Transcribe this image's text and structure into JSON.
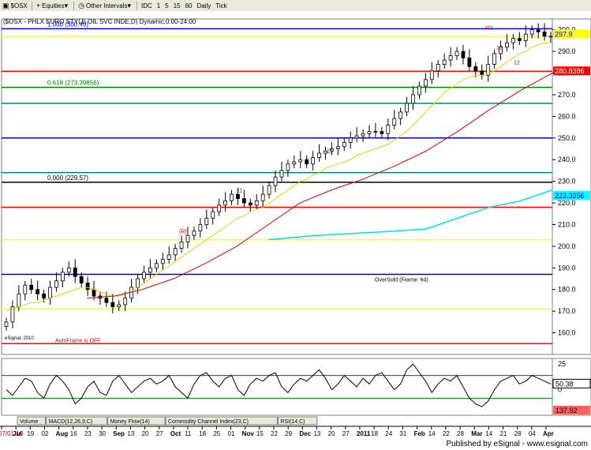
{
  "toolbar": {
    "symbol": "$OSX",
    "category": "Equities",
    "intervals_menu": "Other Intervals",
    "buttons": [
      "IDC",
      "1",
      "5",
      "15",
      "60",
      "Daily",
      "Tick"
    ]
  },
  "chart_data": [
    {
      "type": "candlestick",
      "title": "($OSX - PHLX EURO STYLE OIL SVC INDE,D) Dynamic,0:00-24:00",
      "ylim": [
        150,
        305
      ],
      "y_ticks": [
        160,
        170,
        180,
        190,
        200,
        210,
        220,
        230,
        240,
        250,
        260,
        270,
        280,
        290,
        300
      ],
      "x_ticks": [
        "07/01/10",
        "Jul",
        "19",
        "02",
        "Aug",
        "16",
        "23",
        "30",
        "Sep",
        "13",
        "20",
        "27",
        "Oct",
        "11",
        "18",
        "25",
        "01",
        "Nov",
        "15",
        "22",
        "29",
        "Dec",
        "13",
        "20",
        "27",
        "2011",
        "18",
        "24",
        "31",
        "Feb",
        "14",
        "22",
        "28",
        "Mar",
        "14",
        "21",
        "28",
        "04",
        "Apr"
      ],
      "close_series": [
        165,
        172,
        178,
        182,
        180,
        178,
        176,
        181,
        184,
        188,
        190,
        186,
        183,
        180,
        177,
        176,
        174,
        172,
        173,
        176,
        181,
        185,
        188,
        190,
        192,
        194,
        196,
        199,
        202,
        205,
        207,
        210,
        213,
        216,
        219,
        221,
        224,
        222,
        220,
        219,
        221,
        224,
        228,
        232,
        235,
        238,
        239,
        240,
        238,
        241,
        243,
        244,
        245,
        246,
        248,
        250,
        251,
        252,
        253,
        253,
        252,
        256,
        259,
        262,
        266,
        270,
        274,
        277,
        281,
        284,
        286,
        288,
        290,
        287,
        283,
        281,
        279,
        284,
        289,
        292,
        294,
        296,
        295,
        298,
        300,
        299,
        297,
        297
      ],
      "moving_average_short": [
        170,
        171,
        172,
        173,
        174,
        174,
        175,
        176,
        177,
        178,
        179,
        180,
        181,
        181,
        180,
        179,
        178,
        177,
        177,
        178,
        179,
        181,
        183,
        185,
        187,
        189,
        191,
        193,
        195,
        197,
        199,
        201,
        203,
        205,
        207,
        209,
        211,
        213,
        214,
        216,
        217,
        218,
        220,
        222,
        224,
        226,
        228,
        230,
        231,
        233,
        234,
        236,
        237,
        238,
        239,
        240,
        242,
        243,
        244,
        245,
        246,
        247,
        249,
        251,
        253,
        256,
        259,
        262,
        265,
        268,
        271,
        273,
        275,
        277,
        278,
        279,
        279,
        280,
        281,
        283,
        285,
        287,
        289,
        290,
        292,
        293,
        294,
        294
      ],
      "moving_average_long_points": [
        [
          110,
          176
        ],
        [
          145,
          177
        ],
        [
          180,
          180
        ],
        [
          220,
          185
        ],
        [
          260,
          192
        ],
        [
          300,
          200
        ],
        [
          340,
          210
        ],
        [
          380,
          220
        ],
        [
          420,
          226
        ],
        [
          460,
          231
        ],
        [
          500,
          237
        ],
        [
          540,
          244
        ],
        [
          580,
          253
        ],
        [
          620,
          263
        ],
        [
          660,
          272
        ],
        [
          700,
          280
        ]
      ],
      "moving_average_cyan_points": [
        [
          340,
          203
        ],
        [
          400,
          205
        ],
        [
          450,
          206
        ],
        [
          500,
          207
        ],
        [
          540,
          208
        ],
        [
          580,
          213
        ],
        [
          620,
          218
        ],
        [
          660,
          221
        ],
        [
          700,
          226
        ]
      ],
      "horizontal_levels": [
        {
          "value": 300.49,
          "label": "1.000 (300.49)",
          "color": "#0000ff"
        },
        {
          "value": 273.39856,
          "label": "0.618 (273.39856)",
          "color": "#008000"
        },
        {
          "value": 229.57,
          "label": "0.000 (229.57)",
          "color": "#000000"
        },
        {
          "value": 297,
          "color": "#ffff00"
        },
        {
          "value": 280.8386,
          "color": "#ff0000"
        },
        {
          "value": 266,
          "color": "#008080"
        },
        {
          "value": 250,
          "color": "#0000cc"
        },
        {
          "value": 234,
          "color": "#008080"
        },
        {
          "value": 218,
          "color": "#ff0000"
        },
        {
          "value": 203,
          "color": "#ffff00"
        },
        {
          "value": 187,
          "color": "#0000cc"
        },
        {
          "value": 171,
          "color": "#ffff00"
        },
        {
          "value": 155,
          "color": "#ff0000"
        }
      ],
      "price_labels": [
        {
          "text": "297.9",
          "value": 297.9,
          "bg": "#ffff00",
          "color": "#0000ff"
        },
        {
          "text": "280.8386",
          "value": 280.8386,
          "bg": "#ff0000",
          "color": "#ffffff"
        },
        {
          "text": "223.3356",
          "value": 223.3356,
          "bg": "#00ffff",
          "color": "#0000ff"
        }
      ],
      "annotations": {
        "oversold": "OverSold (Frame: 64)",
        "autoframe": "AutoFrame is OFF",
        "copyright": "eSignal, 2010",
        "count_labels": [
          "101",
          "13",
          "12",
          "11",
          "(R)",
          "13"
        ]
      }
    },
    {
      "type": "line",
      "name": "RSI(14,C)",
      "ylim": [
        0,
        100
      ],
      "y_ticks": [
        25,
        0
      ],
      "current_value": "50.38",
      "bottom_value": "137.92",
      "values": [
        45,
        35,
        50,
        65,
        60,
        40,
        30,
        55,
        70,
        60,
        45,
        20,
        30,
        50,
        60,
        40,
        35,
        60,
        70,
        55,
        40,
        50,
        60,
        65,
        55,
        60,
        70,
        50,
        40,
        30,
        55,
        70,
        75,
        60,
        50,
        65,
        70,
        45,
        35,
        55,
        65,
        60,
        70,
        75,
        50,
        40,
        55,
        65,
        60,
        70,
        80,
        65,
        45,
        55,
        70,
        60,
        50,
        65,
        55,
        70,
        75,
        60,
        45,
        55,
        80,
        90,
        75,
        60,
        40,
        55,
        65,
        60,
        70,
        50,
        30,
        20,
        15,
        25,
        45,
        60,
        65,
        70,
        55,
        60,
        70,
        65,
        60,
        55
      ]
    }
  ],
  "tabs": [
    "Volume",
    "MACD(12,26,9,C)",
    "Money Flow(14)",
    "Commodity Channel Index(23,C)",
    "RSI(14,C)"
  ],
  "footer": {
    "published": "Published by eSignal - www.esignal.com"
  }
}
